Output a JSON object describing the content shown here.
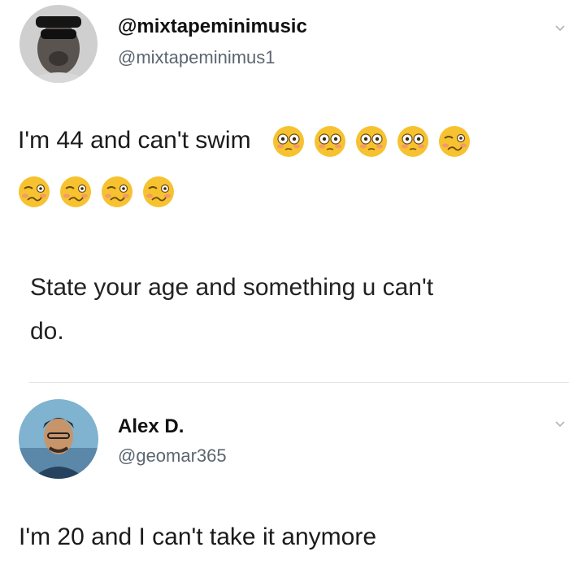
{
  "tweet": {
    "author_name": "@mixtapeminimusic",
    "author_handle": "@mixtapeminimus1",
    "text": "I'm 44 and can't swim",
    "emojis": [
      "flushed-face-emoji",
      "flushed-face-emoji",
      "flushed-face-emoji",
      "flushed-face-emoji",
      "woozy-face-emoji",
      "woozy-face-emoji",
      "woozy-face-emoji",
      "woozy-face-emoji",
      "woozy-face-emoji"
    ],
    "quote_line1": "State your age and something u can't",
    "quote_line2": "do."
  },
  "reply": {
    "author_name": "Alex D.",
    "author_handle": "@geomar365",
    "text": "I'm 20 and I can't take it anymore"
  },
  "colors": {
    "text": "#1b1b1b",
    "handle": "#5b6670",
    "divider": "#e3e5e8",
    "emoji": "#f7c22f"
  }
}
